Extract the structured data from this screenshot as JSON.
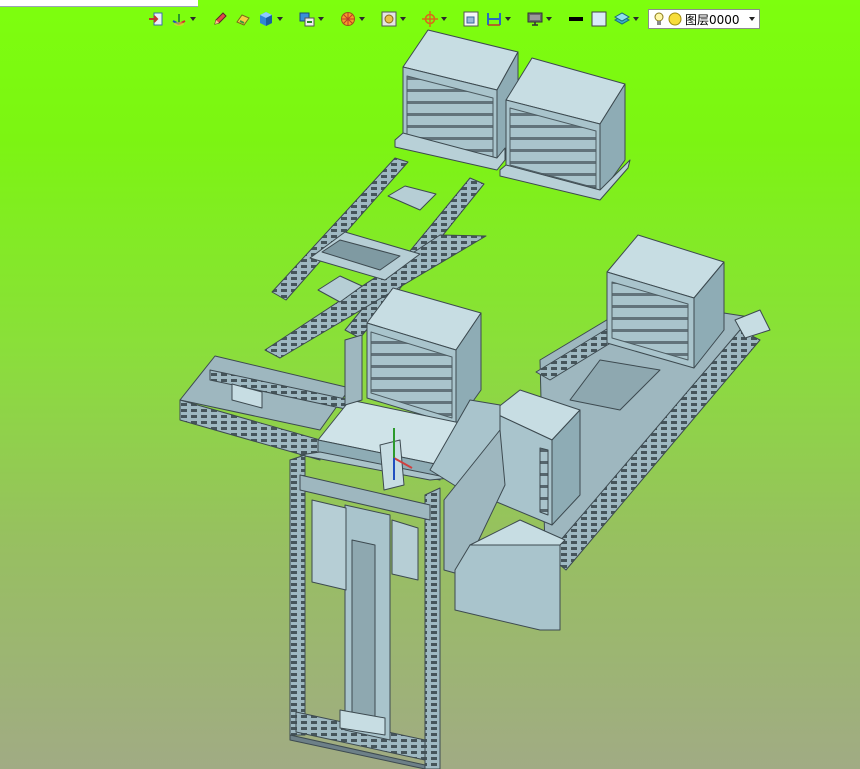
{
  "window": {
    "title_fragment": ""
  },
  "toolbar": {
    "buttons": [
      {
        "name": "exit-sketch-button",
        "icon": "exit-sketch-icon",
        "dropdown": false
      },
      {
        "name": "view-orientation-button",
        "icon": "axes-icon",
        "dropdown": true
      },
      {
        "name": "edit-button",
        "icon": "pencil-icon",
        "dropdown": false
      },
      {
        "name": "section-view-button",
        "icon": "section-icon",
        "dropdown": false
      },
      {
        "name": "display-style-button",
        "icon": "shaded-cube-icon",
        "dropdown": true
      },
      {
        "name": "hide-show-button",
        "icon": "hide-show-icon",
        "dropdown": true
      },
      {
        "name": "appearance-button",
        "icon": "appearance-ball-icon",
        "dropdown": true
      },
      {
        "name": "scene-button",
        "icon": "scene-icon",
        "dropdown": true
      },
      {
        "name": "view-settings-button",
        "icon": "crosshair-icon",
        "dropdown": true
      },
      {
        "name": "zoom-fit-button",
        "icon": "zoom-fit-icon",
        "dropdown": false
      },
      {
        "name": "standard-views-button",
        "icon": "standard-views-icon",
        "dropdown": true
      },
      {
        "name": "monitor-button",
        "icon": "monitor-icon",
        "dropdown": true
      },
      {
        "name": "line-color-button",
        "icon": "line-color-icon",
        "dropdown": false
      },
      {
        "name": "fill-color-button",
        "icon": "fill-color-icon",
        "dropdown": false
      },
      {
        "name": "layer-visibility-button",
        "icon": "layers-icon",
        "dropdown": true
      }
    ],
    "layer": {
      "label": "图层0000",
      "icons": [
        "lightbulb-icon",
        "sun-icon"
      ]
    }
  },
  "colors": {
    "background_top": "#7dff0e",
    "background_bottom": "#a1ab84",
    "part_fill": "#a9c4cc",
    "part_stroke": "#3d4a50"
  }
}
